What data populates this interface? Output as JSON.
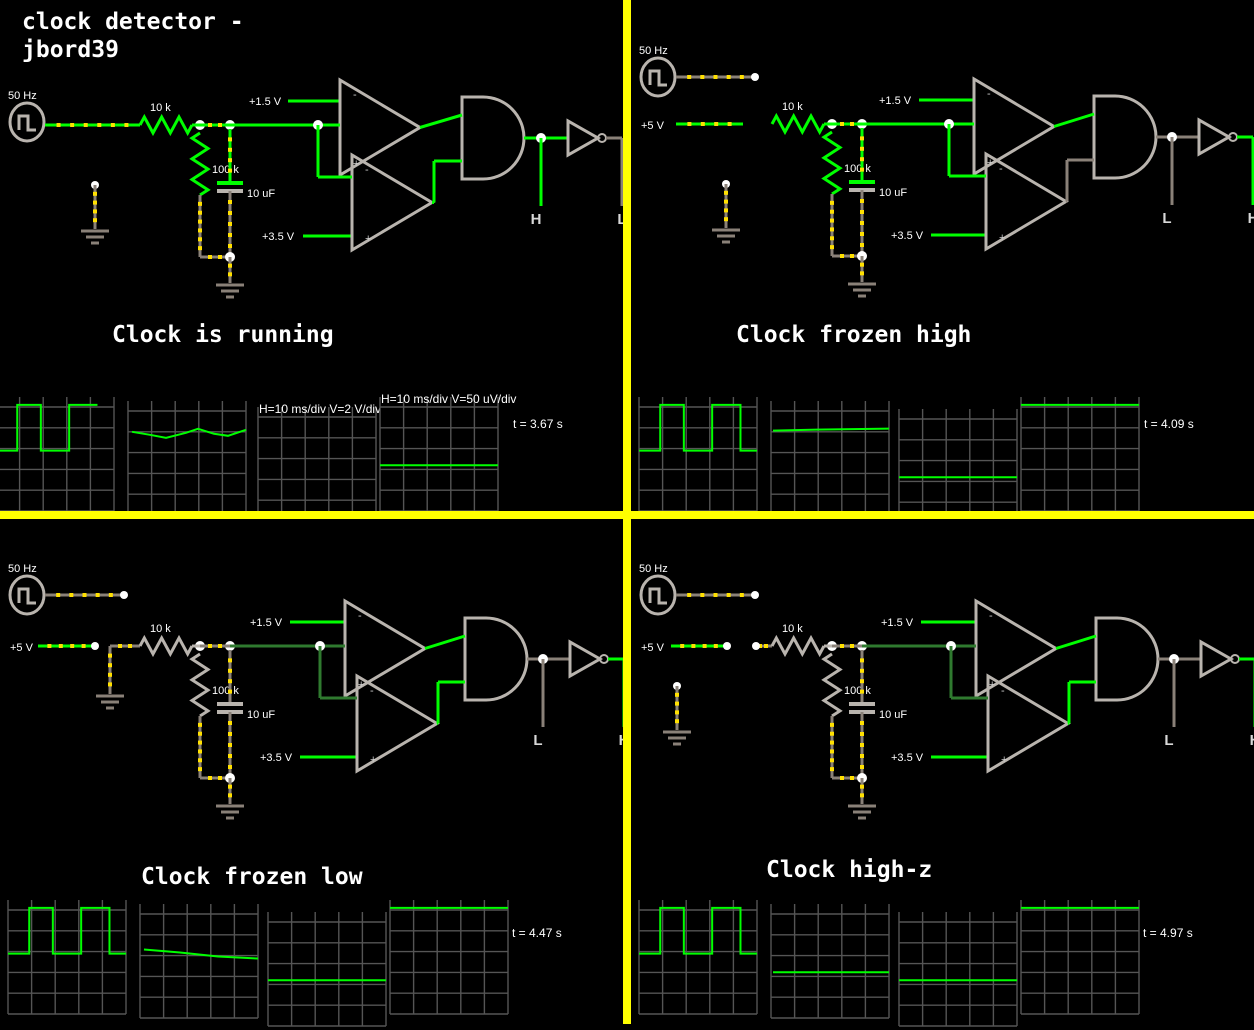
{
  "page": {
    "title_line1": "clock detector -",
    "title_line2": "jbord39",
    "bg_color": "#000000",
    "divider_color": "#ffff00",
    "wire_active_color": "#00ff00",
    "wire_inactive_color": "#8a8178",
    "wire_mid_color": "#2f7a2f",
    "current_dot_color": "#ffe000",
    "node_color": "#ffffff",
    "component_color": "#b9b4ae"
  },
  "labels": {
    "source": "50 Hz",
    "supply": "+5 V",
    "r_series": "10 k",
    "r_pull": "100 k",
    "cap": "10 uF",
    "ref_hi": "+1.5 V",
    "ref_lo": "+3.5 V",
    "out_h": "H",
    "out_l": "L",
    "comp_minus": "-",
    "comp_plus": "+"
  },
  "quadrants": [
    {
      "id": "q1",
      "caption": "Clock is running",
      "has_title": true,
      "source_connected": true,
      "supply_shown": false,
      "out_left_label": "H",
      "out_right_label": "L",
      "time": "t = 3.67 s",
      "scopes": [
        {
          "name": "clock-input-scope",
          "trace": "square",
          "hlabel": "",
          "vlabel": ""
        },
        {
          "name": "filtered-node-scope",
          "trace": "ripple",
          "hlabel": "",
          "vlabel": ""
        },
        {
          "name": "comparator-window-scope",
          "trace": "none",
          "hlabel": "H=10 ms/div",
          "vlabel": "V=2 V/div"
        },
        {
          "name": "detector-output-scope",
          "trace": "flat-mid",
          "hlabel": "H=10 ms/div",
          "vlabel": "V=50 uV/div"
        }
      ]
    },
    {
      "id": "q2",
      "caption": "Clock frozen high",
      "has_title": false,
      "source_connected": false,
      "supply_shown": true,
      "out_left_label": "L",
      "out_right_label": "H",
      "time": "t = 4.09 s",
      "scopes": [
        {
          "name": "clock-input-scope",
          "trace": "square",
          "hlabel": "",
          "vlabel": ""
        },
        {
          "name": "filtered-node-scope",
          "trace": "flat-high",
          "hlabel": "",
          "vlabel": ""
        },
        {
          "name": "comparator-window-scope",
          "trace": "flat-mid",
          "hlabel": "",
          "vlabel": ""
        },
        {
          "name": "detector-output-scope",
          "trace": "flat-top",
          "hlabel": "",
          "vlabel": ""
        }
      ]
    },
    {
      "id": "q3",
      "caption": "Clock frozen low",
      "has_title": false,
      "source_connected": false,
      "supply_shown": true,
      "out_left_label": "L",
      "out_right_label": "H",
      "time": "t = 4.47 s",
      "scopes": [
        {
          "name": "clock-input-scope",
          "trace": "square",
          "hlabel": "",
          "vlabel": ""
        },
        {
          "name": "filtered-node-scope",
          "trace": "decay",
          "hlabel": "",
          "vlabel": ""
        },
        {
          "name": "comparator-window-scope",
          "trace": "flat-mid",
          "hlabel": "",
          "vlabel": ""
        },
        {
          "name": "detector-output-scope",
          "trace": "flat-top",
          "hlabel": "",
          "vlabel": ""
        }
      ]
    },
    {
      "id": "q4",
      "caption": "Clock high-z",
      "has_title": false,
      "source_connected": false,
      "supply_shown": true,
      "out_left_label": "L",
      "out_right_label": "H",
      "time": "t = 4.97 s",
      "scopes": [
        {
          "name": "clock-input-scope",
          "trace": "square",
          "hlabel": "",
          "vlabel": ""
        },
        {
          "name": "filtered-node-scope",
          "trace": "flat-low",
          "hlabel": "",
          "vlabel": ""
        },
        {
          "name": "comparator-window-scope",
          "trace": "flat-mid",
          "hlabel": "",
          "vlabel": ""
        },
        {
          "name": "detector-output-scope",
          "trace": "flat-top",
          "hlabel": "",
          "vlabel": ""
        }
      ]
    }
  ],
  "scope_settings": {
    "h_per_div": "H=10 ms/div",
    "v_per_div_2v": "V=2 V/div",
    "v_per_div_50uv": "V=50 uV/div"
  }
}
